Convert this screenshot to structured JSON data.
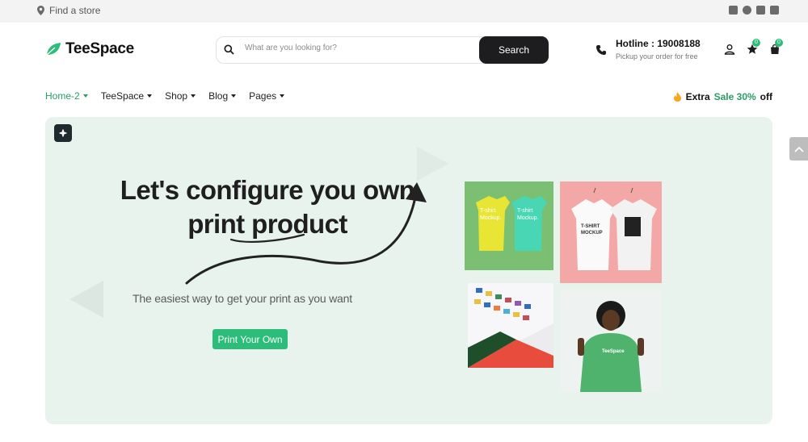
{
  "topbar": {
    "store_label": "Find a store",
    "socials": [
      "twitter-icon",
      "facebook-icon",
      "instagram-icon",
      "youtube-icon"
    ]
  },
  "brand": {
    "name": "TeeSpace",
    "accent": "#2dbd7a"
  },
  "search": {
    "placeholder": "What are you looking for?",
    "button": "Search"
  },
  "hotline": {
    "title": "Hotline : 19008188",
    "subtitle": "Pickup your order for free"
  },
  "header_icons": {
    "wishlist_count": "0",
    "cart_count": "0"
  },
  "nav": {
    "items": [
      "Home-2",
      "TeeSpace",
      "Shop",
      "Blog",
      "Pages"
    ],
    "active": "Home-2"
  },
  "promo": {
    "prefix": "Extra",
    "highlight": "Sale 30%",
    "suffix": "off"
  },
  "hero": {
    "title_line1": "Let's configure you own",
    "title_line2": "print product",
    "subtitle": "The easiest way to get your print as you want",
    "cta": "Print Your Own",
    "tiles": [
      {
        "caption_1": "T-shirt Mockup.",
        "caption_2": "T-shirt Mockup."
      },
      {
        "caption_1": "T-SHIRT MOCKUP"
      },
      {},
      {
        "caption_1": "TeeSpace"
      }
    ]
  },
  "colors": {
    "hero_bg": "#e8f3ee",
    "dark": "#1d1d1f",
    "green": "#2dbd7a"
  }
}
